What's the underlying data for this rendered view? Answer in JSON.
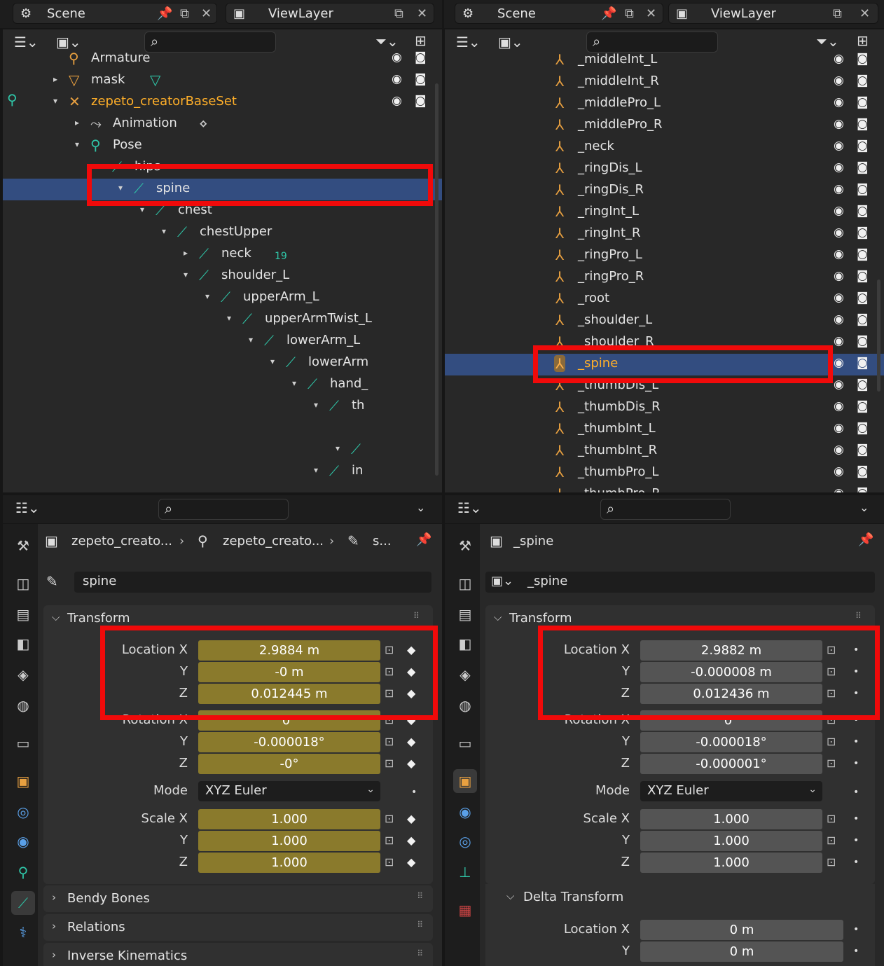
{
  "top_left_header": {
    "scene": "Scene",
    "view_layer": "ViewLayer"
  },
  "top_right_header": {
    "scene": "Scene",
    "view_layer": "ViewLayer"
  },
  "outliner_left": {
    "rows": [
      {
        "label": "Armature",
        "indent": 0
      },
      {
        "label": "mask",
        "indent": 0
      },
      {
        "label": "zepeto_creatorBaseSet",
        "indent": 0
      },
      {
        "label": "Animation",
        "indent": 1
      },
      {
        "label": "Pose",
        "indent": 1
      },
      {
        "label": "hips",
        "indent": 2
      },
      {
        "label": "spine",
        "indent": 3
      },
      {
        "label": "chest",
        "indent": 4
      },
      {
        "label": "chestUpper",
        "indent": 5
      },
      {
        "label": "neck",
        "indent": 6,
        "badge": "19"
      },
      {
        "label": "shoulder_L",
        "indent": 6
      },
      {
        "label": "upperArm_L",
        "indent": 7
      },
      {
        "label": "upperArmTwist_L",
        "indent": 8
      },
      {
        "label": "lowerArm_L",
        "indent": 9
      },
      {
        "label": "lowerArm",
        "indent": 10
      },
      {
        "label": "hand_",
        "indent": 11
      },
      {
        "label": "th",
        "indent": 12
      },
      {
        "label": "",
        "indent": 13
      },
      {
        "label": "",
        "indent": 13
      },
      {
        "label": "in",
        "indent": 12
      }
    ]
  },
  "outliner_right": {
    "rows": [
      "_middleInt_L",
      "_middleInt_R",
      "_middlePro_L",
      "_middlePro_R",
      "_neck",
      "_ringDis_L",
      "_ringDis_R",
      "_ringInt_L",
      "_ringInt_R",
      "_ringPro_L",
      "_ringPro_R",
      "_root",
      "_shoulder_L",
      "_shoulder_R",
      "_spine",
      "_thumbDis_L",
      "_thumbDis_R",
      "_thumbInt_L",
      "_thumbInt_R",
      "_thumbPro_L",
      "_thumbPro_R"
    ]
  },
  "props_left": {
    "breadcrumb": [
      "zepeto_creato...",
      "zepeto_creato...",
      "s..."
    ],
    "name": "spine",
    "transform_label": "Transform",
    "labels": {
      "location_x": "Location X",
      "y": "Y",
      "z": "Z",
      "rotation_x": "Rotation X",
      "mode": "Mode",
      "scale_x": "Scale X"
    },
    "location": [
      "2.9884 m",
      "-0 m",
      "0.012445 m"
    ],
    "rotation": [
      "0°",
      "-0.000018°",
      "-0°"
    ],
    "mode": "XYZ Euler",
    "scale": [
      "1.000",
      "1.000",
      "1.000"
    ],
    "sections": [
      "Bendy Bones",
      "Relations",
      "Inverse Kinematics"
    ]
  },
  "props_right": {
    "breadcrumb": "_spine",
    "name": "_spine",
    "transform_label": "Transform",
    "labels": {
      "location_x": "Location X",
      "y": "Y",
      "z": "Z",
      "rotation_x": "Rotation X",
      "mode": "Mode",
      "scale_x": "Scale X"
    },
    "location": [
      "2.9882 m",
      "-0.000008 m",
      "0.012436 m"
    ],
    "rotation": [
      "0°",
      "-0.000018°",
      "-0.000001°"
    ],
    "mode": "XYZ Euler",
    "scale": [
      "1.000",
      "1.000",
      "1.000"
    ],
    "delta_label": "Delta Transform",
    "delta_location": [
      "0 m",
      "0 m"
    ]
  },
  "colors": {
    "selection": "#334d80",
    "highlight": "#f00a0a",
    "animated_field": "#8a7a2c",
    "bone": "#2fc6a8",
    "object": "#e8a040"
  }
}
